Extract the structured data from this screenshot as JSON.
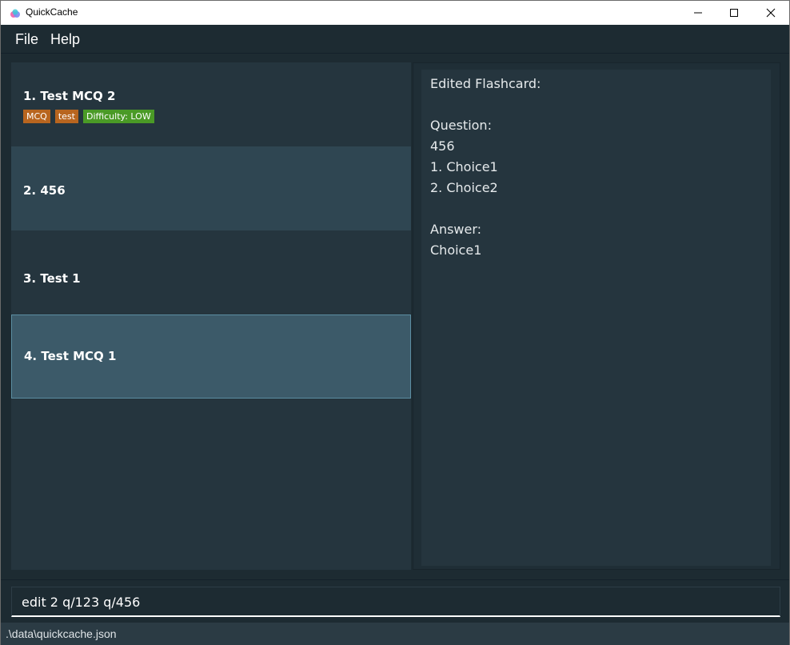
{
  "window": {
    "title": "QuickCache",
    "icon": "app-icon",
    "controls": [
      "minimize-icon",
      "maximize-icon",
      "close-icon"
    ]
  },
  "menu": {
    "file": "File",
    "help": "Help"
  },
  "flashcards": [
    {
      "title": "1.  Test MCQ 2",
      "tags": [
        "MCQ",
        "test"
      ],
      "difficulty": "Difficulty: LOW"
    },
    {
      "title": "2.  456"
    },
    {
      "title": "3.  Test 1"
    },
    {
      "title": "4.  Test MCQ 1",
      "selected": true
    }
  ],
  "detail": {
    "heading": "Edited Flashcard:",
    "question_label": "Question:",
    "question": "456",
    "choice1": "1. Choice1",
    "choice2": "2. Choice2",
    "answer_label": "Answer:",
    "answer": "Choice1"
  },
  "command": {
    "value": "edit 2 q/123 q/456"
  },
  "status": {
    "path": ".\\data\\quickcache.json"
  },
  "colors": {
    "tag": "#b8651f",
    "difficulty_low": "#4a9a26",
    "card_alt": "#2f4652",
    "card_selected": "#3c5a69",
    "card_selected_border": "#5c8ea2"
  }
}
